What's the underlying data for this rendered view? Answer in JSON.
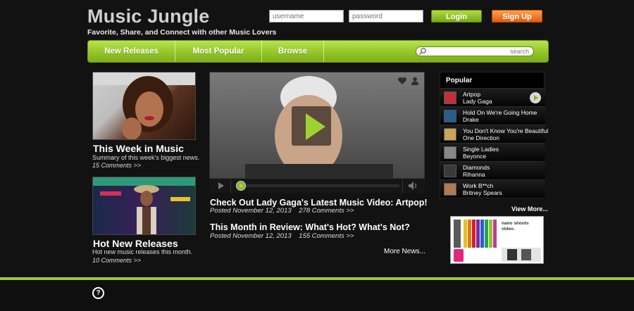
{
  "header": {
    "title": "Music Jungle",
    "tagline": "Favorite, Share, and Connect with other Music Lovers",
    "username_placeholder": "username",
    "password_placeholder": "password",
    "login_label": "Login",
    "signup_label": "Sign Up"
  },
  "nav": {
    "items": [
      {
        "label": "New Releases"
      },
      {
        "label": "Most Popular"
      },
      {
        "label": "Browse"
      }
    ],
    "search_placeholder": "search"
  },
  "left": {
    "week": {
      "title": "This Week in Music",
      "desc": "Summary of this week's biggest news.",
      "link": "15 Comments >>"
    },
    "releases": {
      "title": "Hot New Releases",
      "desc": "Hot new music releases this month.",
      "link": "10 Comments >>"
    }
  },
  "news": [
    {
      "title": "Check Out Lady Gaga's Latest Music Video: Artpop!",
      "date": "Posted November 12, 2013",
      "comments": "278 Comments >>"
    },
    {
      "title": "This Month in Review: What's Hot? What's Not?",
      "date": "Posted November 12, 2013",
      "comments": "155 Comments >>"
    }
  ],
  "more_news": "More News...",
  "popular": {
    "heading": "Popular",
    "items": [
      {
        "song": "Artpop",
        "artist": "Lady Gaga",
        "color": "#c0303a"
      },
      {
        "song": "Hold On We're Going Home",
        "artist": "Drake",
        "color": "#2a5c8c"
      },
      {
        "song": "You Don't Know You're Beautiful",
        "artist": "One Direction",
        "color": "#c9a45a"
      },
      {
        "song": "Single Ladies",
        "artist": "Beyonce",
        "color": "#888888"
      },
      {
        "song": "Diamonds",
        "artist": "Rihanna",
        "color": "#3a3a3a"
      },
      {
        "song": "Work B**ch",
        "artist": "Britney Spears",
        "color": "#b07a52"
      }
    ],
    "view_more": "View More..."
  },
  "ad": {
    "text": "nano shoots video."
  },
  "colors": {
    "accent_green": "#97c82c",
    "signup_orange": "#f07a22",
    "background": "#121212"
  }
}
